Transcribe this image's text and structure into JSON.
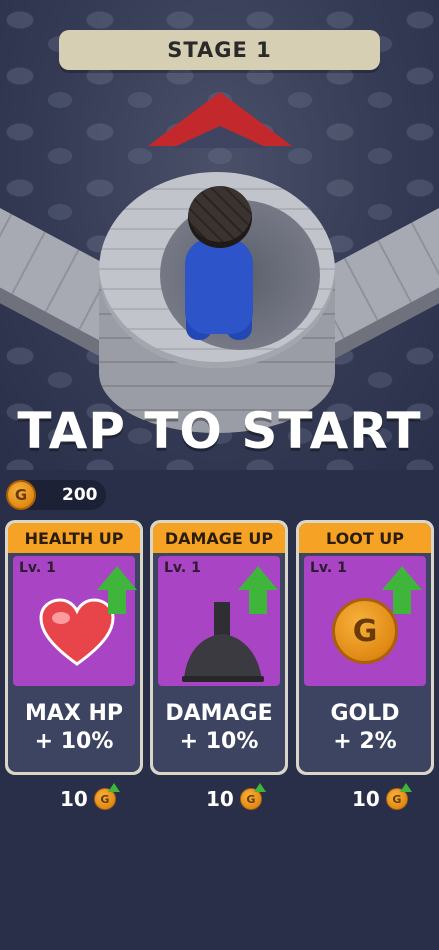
{
  "stage": {
    "label": "STAGE 1"
  },
  "prompt": {
    "text": "TAP TO START"
  },
  "wallet": {
    "coin_letter": "G",
    "amount": "200"
  },
  "cards": [
    {
      "title": "HEALTH UP",
      "level": "Lv. 1",
      "line1": "MAX HP",
      "line2": "+ 10%",
      "cost": "10",
      "icon": "heart-icon"
    },
    {
      "title": "DAMAGE UP",
      "level": "Lv. 1",
      "line1": "DAMAGE",
      "line2": "+ 10%",
      "cost": "10",
      "icon": "bell-weight-icon"
    },
    {
      "title": "LOOT UP",
      "level": "Lv. 1",
      "line1": "GOLD",
      "line2": "+ 2%",
      "cost": "10",
      "icon": "gold-coin-icon",
      "coin_letter": "G"
    }
  ],
  "cost_coin_letter": "G",
  "colors": {
    "background": "#2a2f49",
    "card_header": "#f6a325",
    "card_art": "#a944c5",
    "upgrade_arrow": "#3fb53c",
    "direction_marker": "#c2282c",
    "player": "#2d55c9"
  }
}
